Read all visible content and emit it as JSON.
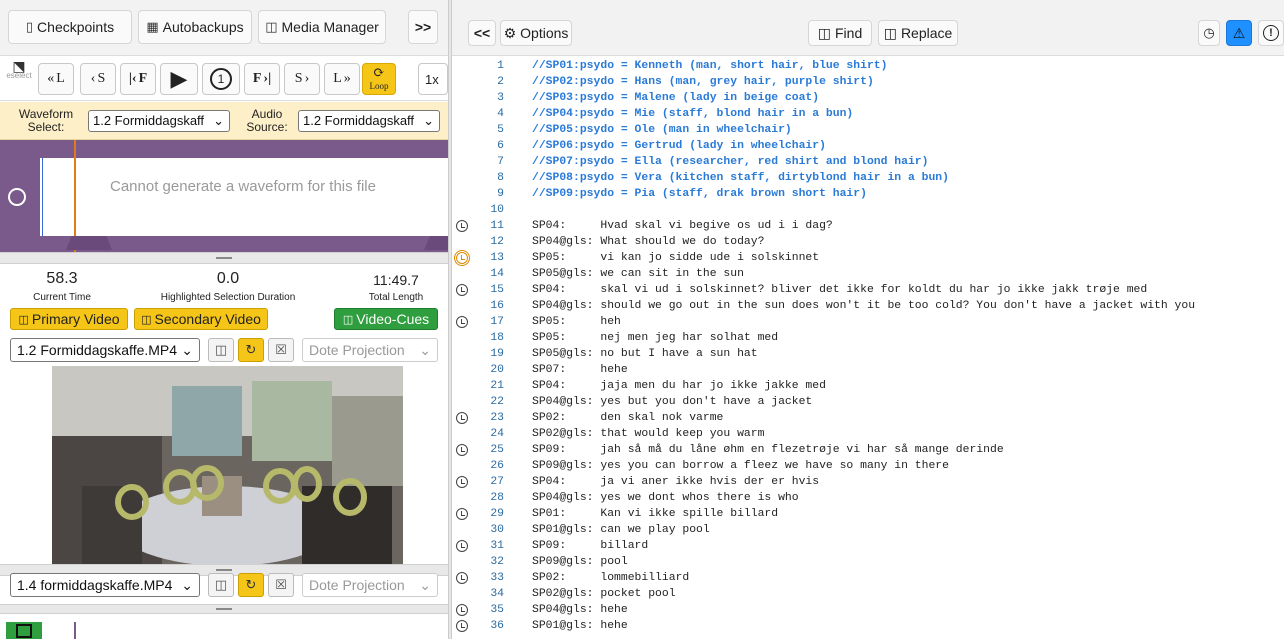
{
  "left_toolbar": {
    "checkpoints": "Checkpoints",
    "autobackups": "Autobackups",
    "media_manager": "Media Manager",
    "expand": ">>"
  },
  "playback": {
    "deselect": "eselect",
    "prev_line": "L",
    "prev_seg": "S",
    "first_frame": "F",
    "replay_label": "1",
    "next_frame": "F",
    "next_seg": "S",
    "next_line": "L",
    "loop": "Loop",
    "speed": "1x"
  },
  "waveform_select": {
    "label": "Waveform Select:",
    "value": "1.2 Formiddagskaff",
    "audio_label": "Audio Source:",
    "audio_value": "1.2 Formiddagskaff"
  },
  "waveform": {
    "message": "Cannot generate a waveform for this file",
    "playhead_fraction": 0.084
  },
  "times": {
    "current": "58.3",
    "current_label": "Current Time",
    "highlight": "0.0",
    "highlight_label": "Highlighted Selection Duration",
    "total": "11:49.7",
    "total_label": "Total Length"
  },
  "video_buttons": {
    "primary": "Primary Video",
    "secondary": "Secondary Video",
    "cues": "Video-Cues"
  },
  "video1": {
    "file": "1.2 Formiddagskaffe.MP4",
    "projection": "Dote Projection"
  },
  "video2": {
    "file": "1.4 formiddagskaffe.MP4",
    "projection": "Dote Projection"
  },
  "right_toolbar": {
    "collapse": "<<",
    "options": "Options",
    "find": "Find",
    "replace": "Replace"
  },
  "colors": {
    "accent_yellow": "#f5c518",
    "video_cues_green": "#2e9e3e",
    "alert_blue": "#1e90ff",
    "waveform_purple": "#7a5a8a",
    "header_blue": "#2a7ad8"
  },
  "lines": [
    {
      "n": "1",
      "t": "//SP01:psydo = Kenneth (man, short hair, blue shirt)",
      "hdr": true
    },
    {
      "n": "2",
      "t": "//SP02:psydo = Hans (man, grey hair, purple shirt)",
      "hdr": true
    },
    {
      "n": "3",
      "t": "//SP03:psydo = Malene (lady in beige coat)",
      "hdr": true
    },
    {
      "n": "4",
      "t": "//SP04:psydo = Mie (staff, blond hair in a bun)",
      "hdr": true
    },
    {
      "n": "5",
      "t": "//SP05:psydo = Ole (man in wheelchair)",
      "hdr": true
    },
    {
      "n": "6",
      "t": "//SP06:psydo = Gertrud (lady in wheelchair)",
      "hdr": true
    },
    {
      "n": "7",
      "t": "//SP07:psydo = Ella (researcher, red shirt and blond hair)",
      "hdr": true
    },
    {
      "n": "8",
      "t": "//SP08:psydo = Vera (kitchen staff, dirtyblond hair in a bun)",
      "hdr": true
    },
    {
      "n": "9",
      "t": "//SP09:psydo = Pia (staff, drak brown short hair)",
      "hdr": true
    },
    {
      "n": "10",
      "t": ""
    },
    {
      "n": "11",
      "t": "SP04:     Hvad skal vi begive os ud i i dag?",
      "clk": true
    },
    {
      "n": "12",
      "t": "SP04@gls: What should we do today?"
    },
    {
      "n": "13",
      "t": "SP05:     vi kan jo sidde ude i solskinnet",
      "clk": "active"
    },
    {
      "n": "14",
      "t": "SP05@gls: we can sit in the sun"
    },
    {
      "n": "15",
      "t": "SP04:     skal vi ud i solskinnet? bliver det ikke for koldt du har jo ikke jakk trøje med",
      "clk": true
    },
    {
      "n": "16",
      "t": "SP04@gls: should we go out in the sun does won't it be too cold? You don't have a jacket with you"
    },
    {
      "n": "17",
      "t": "SP05:     heh",
      "clk": true
    },
    {
      "n": "18",
      "t": "SP05:     nej men jeg har solhat med"
    },
    {
      "n": "19",
      "t": "SP05@gls: no but I have a sun hat"
    },
    {
      "n": "20",
      "t": "SP07:     hehe"
    },
    {
      "n": "21",
      "t": "SP04:     jaja men du har jo ikke jakke med"
    },
    {
      "n": "22",
      "t": "SP04@gls: yes but you don't have a jacket"
    },
    {
      "n": "23",
      "t": "SP02:     den skal nok varme",
      "clk": true
    },
    {
      "n": "24",
      "t": "SP02@gls: that would keep you warm"
    },
    {
      "n": "25",
      "t": "SP09:     jah så må du låne øhm en flezetrøje vi har så mange derinde",
      "clk": true
    },
    {
      "n": "26",
      "t": "SP09@gls: yes you can borrow a fleez we have so many in there"
    },
    {
      "n": "27",
      "t": "SP04:     ja vi aner ikke hvis der er hvis",
      "clk": true
    },
    {
      "n": "28",
      "t": "SP04@gls: yes we dont whos there is who"
    },
    {
      "n": "29",
      "t": "SP01:     Kan vi ikke spille billard",
      "clk": true
    },
    {
      "n": "30",
      "t": "SP01@gls: can we play pool"
    },
    {
      "n": "31",
      "t": "SP09:     billard",
      "clk": true
    },
    {
      "n": "32",
      "t": "SP09@gls: pool"
    },
    {
      "n": "33",
      "t": "SP02:     lommebilliard",
      "clk": true
    },
    {
      "n": "34",
      "t": "SP02@gls: pocket pool"
    },
    {
      "n": "35",
      "t": "SP04@gls: hehe",
      "clk": true
    },
    {
      "n": "36",
      "t": "SP01@gls: hehe",
      "clk": true
    }
  ]
}
